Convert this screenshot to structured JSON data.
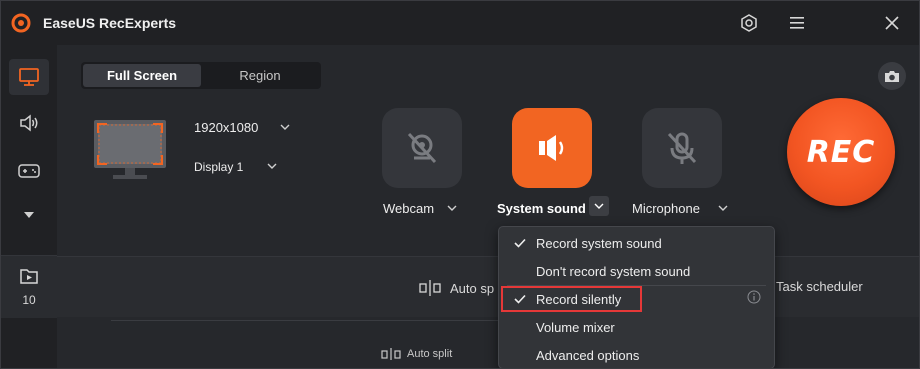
{
  "app": {
    "title": "EaseUS RecExperts"
  },
  "colors": {
    "accent": "#f26522",
    "highlight": "#e53838"
  },
  "titlebar": {
    "icons": [
      "settings-icon",
      "menu-icon",
      "close-icon"
    ]
  },
  "sidebar": {
    "items": [
      {
        "name": "screen-icon",
        "active": true
      },
      {
        "name": "audio-icon",
        "active": false
      },
      {
        "name": "game-icon",
        "active": false
      },
      {
        "name": "more-arrow-icon",
        "active": false
      }
    ],
    "recordings_count": "10"
  },
  "mode_tabs": {
    "full_screen": "Full Screen",
    "region": "Region"
  },
  "display": {
    "resolution": "1920x1080",
    "display_name": "Display 1"
  },
  "sources": {
    "webcam": "Webcam",
    "system_sound": "System sound",
    "microphone": "Microphone"
  },
  "rec_button": "REC",
  "bottom": {
    "auto_split_top": "Auto sp",
    "task_scheduler": "Task scheduler",
    "auto_split_bottom": "Auto split"
  },
  "dropdown": {
    "items": [
      {
        "label": "Record system sound",
        "checked": true
      },
      {
        "label": "Don't record system sound",
        "checked": false
      },
      {
        "label": "Record silently",
        "checked": true
      },
      {
        "label": "Volume mixer",
        "checked": false
      },
      {
        "label": "Advanced options",
        "checked": false
      }
    ]
  }
}
